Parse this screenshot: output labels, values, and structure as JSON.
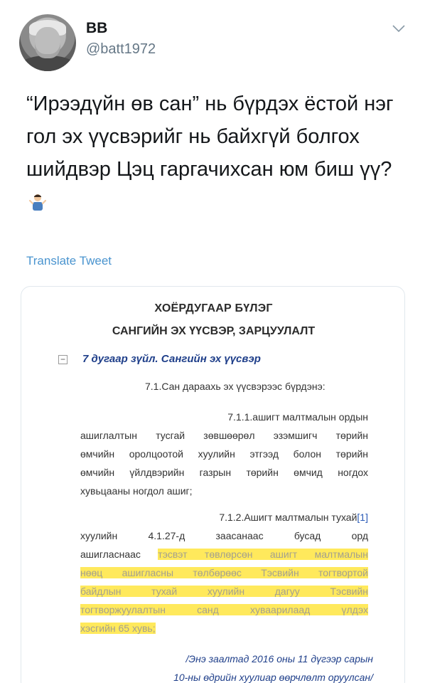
{
  "tweet": {
    "author": {
      "name": "BB",
      "handle": "@batt1972"
    },
    "text": "“Ирээдүйн өв сан” нь бүрдэх ёстой нэг гол эх үүсвэрийг нь байхгүй болгох шийдвэр Цэц гаргачихсан юм биш үү?",
    "emoji_name": "person-shrugging-icon",
    "translate_label": "Translate Tweet"
  },
  "document": {
    "heading1": "ХОЁРДУГААР БҮЛЭГ",
    "heading2": "САНГИЙН ЭХ ҮҮСВЭР, ЗАРЦУУЛАЛТ",
    "collapse_symbol": "−",
    "article_title": "7 дугаар зүйл. Сангийн эх үүсвэр",
    "p71": "7.1.Сан дараахь эх үүсвэрээс бүрдэнэ:",
    "p711_lines": [
      "7.1.1.ашигт малтмалын ордын",
      "ашиглалтын тусгай зөвшөөрөл эзэмшигч төрийн",
      "өмчийн оролцоотой хуулийн этгээд болон төрийн",
      "өмчийн үйлдвэрийн газрын төрийн өмчид ногдох",
      "хувьцааны ногдол ашиг;"
    ],
    "p712": {
      "line1_text": "7.1.2.Ашигт малтмалын тухай",
      "line1_ref": "[1]",
      "line2": "хуулийн 4.1.27-д заасанаас бусад орд",
      "line3_plain": "ашигласнаас ",
      "line3_highlight": "тэсвэт төвлөрсөн ашигт малтмалын",
      "line4_highlight": "нөөц ашигласны төлбөрөөс Тэсвийн тогтвортой",
      "line5_highlight": "байдлын тухай хуулийн дагуу Тэсвийн",
      "line6_highlight": "тогтворжуулалтын санд хуваарилаад үлдэх",
      "line7_highlight": "хэсгийн 65 хувь;"
    },
    "footnote_lines": [
      "/Энэ заалтад 2016 оны 11 дүгээр сарын",
      "10-ны өдрийн хуулиар өөрчлөлт оруулсан/"
    ]
  },
  "colors": {
    "text": "#14171a",
    "secondary": "#657786",
    "link": "#4a94cf",
    "highlight": "#ffe95c",
    "doc_heading_blue": "#1f3f8a"
  }
}
